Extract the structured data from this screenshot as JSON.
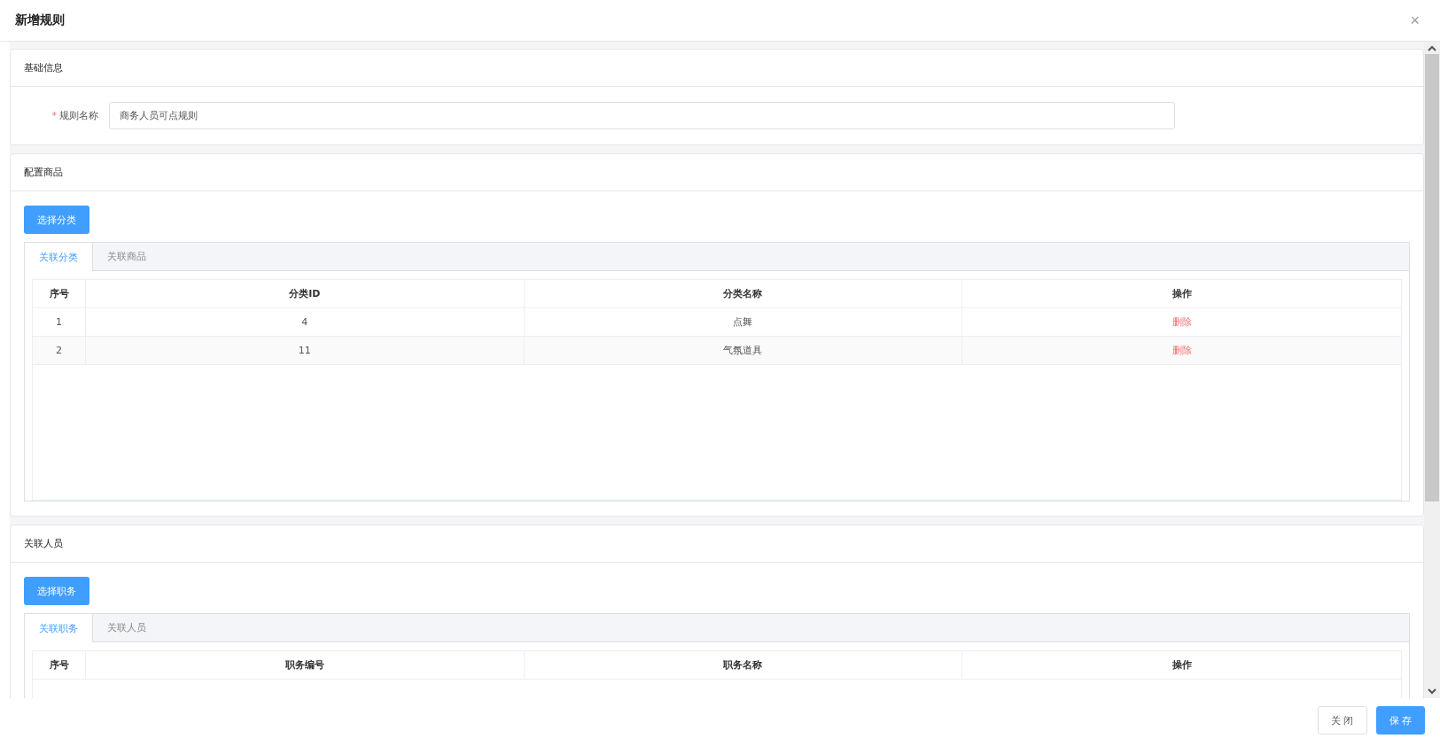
{
  "dialog": {
    "title": "新增规则",
    "close_icon": "×"
  },
  "basic_info": {
    "title": "基础信息",
    "fields": [
      {
        "label": "规则名称",
        "required_mark": "*",
        "value": "商务人员可点规则"
      }
    ]
  },
  "products": {
    "title": "配置商品",
    "button": "选择分类",
    "tabs": [
      {
        "label": "关联分类",
        "selected": true
      },
      {
        "label": "关联商品",
        "selected": false
      }
    ],
    "table": {
      "columns": [
        "序号",
        "分类ID",
        "分类名称",
        "操作"
      ],
      "rows": [
        {
          "cells": [
            "1",
            "4",
            "点舞"
          ],
          "action": "删除"
        },
        {
          "cells": [
            "2",
            "11",
            "气氛道具"
          ],
          "action": "删除"
        }
      ]
    }
  },
  "people": {
    "title": "关联人员",
    "button": "选择职务",
    "tabs": [
      {
        "label": "关联职务",
        "selected": true
      },
      {
        "label": "关联人员",
        "selected": false
      }
    ],
    "table": {
      "columns": [
        "序号",
        "职务编号",
        "职务名称",
        "操作"
      ]
    }
  },
  "footer": {
    "buttons": [
      {
        "label": "关 闭",
        "kind": "default"
      },
      {
        "label": "保 存",
        "kind": "primary"
      }
    ]
  }
}
